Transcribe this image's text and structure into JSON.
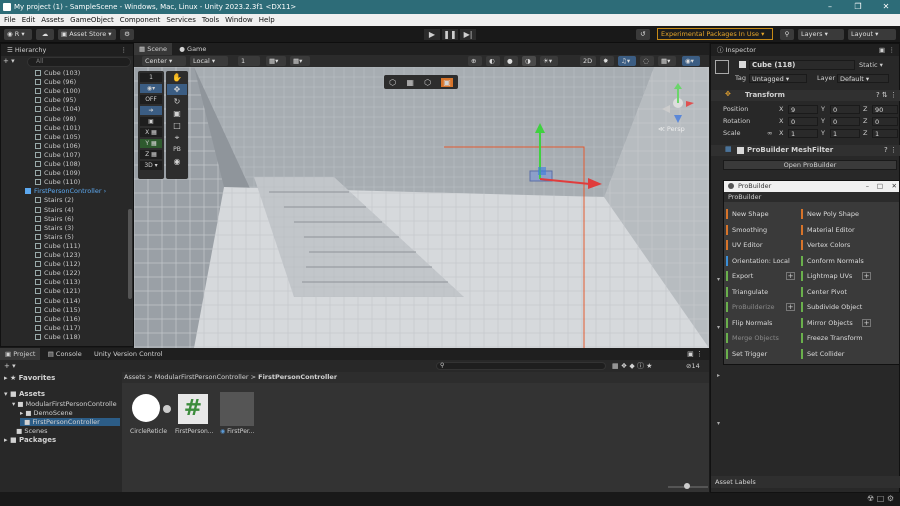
{
  "window": {
    "title": "My project (1) - SampleScene - Windows, Mac, Linux - Unity 2023.2.3f1 <DX11>"
  },
  "menu": [
    "File",
    "Edit",
    "Assets",
    "GameObject",
    "Component",
    "Services",
    "Tools",
    "Window",
    "Help"
  ],
  "toolbar": {
    "account": "R",
    "asset_store": "Asset Store",
    "experimental": "Experimental Packages In Use",
    "layers": "Layers",
    "layout": "Layout"
  },
  "hierarchy": {
    "title": "Hierarchy",
    "search": "All",
    "items": [
      "Cube (103)",
      "Cube (96)",
      "Cube (100)",
      "Cube (95)",
      "Cube (104)",
      "Cube (98)",
      "Cube (101)",
      "Cube (105)",
      "Cube (106)",
      "Cube (107)",
      "Cube (108)",
      "Cube (109)",
      "Cube (110)",
      "FirstPersonController",
      "Stairs (2)",
      "Stairs (4)",
      "Stairs (6)",
      "Stairs (3)",
      "Stairs (5)",
      "Cube (111)",
      "Cube (123)",
      "Cube (112)",
      "Cube (122)",
      "Cube (113)",
      "Cube (121)",
      "Cube (114)",
      "Cube (115)",
      "Cube (116)",
      "Cube (117)",
      "Cube (118)"
    ]
  },
  "scene": {
    "tabs": [
      "Scene",
      "Game"
    ],
    "pivot": "Center",
    "space": "Local",
    "snap_value": "1",
    "mode_2d": "2D",
    "persp": "Persp",
    "tools": {
      "off": "OFF",
      "pb": "PB",
      "view_3d": "3D",
      "one": "1"
    },
    "axes": {
      "x": "X",
      "y": "Y",
      "z": "Z"
    }
  },
  "inspector": {
    "title": "Inspector",
    "object_name": "Cube (118)",
    "static": "Static",
    "tag_label": "Tag",
    "tag": "Untagged",
    "layer_label": "Layer",
    "layer": "Default",
    "transform": {
      "title": "Transform",
      "position": {
        "label": "Position",
        "x": "9",
        "y": "0",
        "z": "90"
      },
      "rotation": {
        "label": "Rotation",
        "x": "0",
        "y": "0",
        "z": "0"
      },
      "scale": {
        "label": "Scale",
        "x": "1",
        "y": "1",
        "z": "1"
      }
    },
    "meshfilter": {
      "title": "ProBuilder MeshFilter",
      "button": "Open ProBuilder"
    },
    "asset_labels": "Asset Labels"
  },
  "probuilder": {
    "title": "ProBuilder",
    "menu": "ProBuilder",
    "left": [
      "New Shape",
      "Smoothing",
      "UV Editor",
      "Orientation: Local",
      "Export",
      "Triangulate",
      "ProBuilderize",
      "Flip Normals",
      "Merge Objects",
      "Set Trigger"
    ],
    "right": [
      "New Poly Shape",
      "Material Editor",
      "Vertex Colors",
      "Conform Normals",
      "Lightmap UVs",
      "Center Pivot",
      "Subdivide Object",
      "Mirror Objects",
      "Freeze Transform",
      "Set Collider"
    ]
  },
  "project": {
    "tabs": [
      "Project",
      "Console",
      "Unity Version Control"
    ],
    "tree": {
      "favorites": "Favorites",
      "assets": "Assets",
      "modular": "ModularFirstPersonControlle",
      "demoscene": "DemoScene",
      "fpc": "FirstPersonController",
      "scenes": "Scenes",
      "packages": "Packages"
    },
    "breadcrumb": [
      "Assets",
      "ModularFirstPersonController",
      "FirstPersonController"
    ],
    "count": "14",
    "files": [
      "CircleReticle",
      "FirstPerson...",
      "FirstPer..."
    ]
  }
}
